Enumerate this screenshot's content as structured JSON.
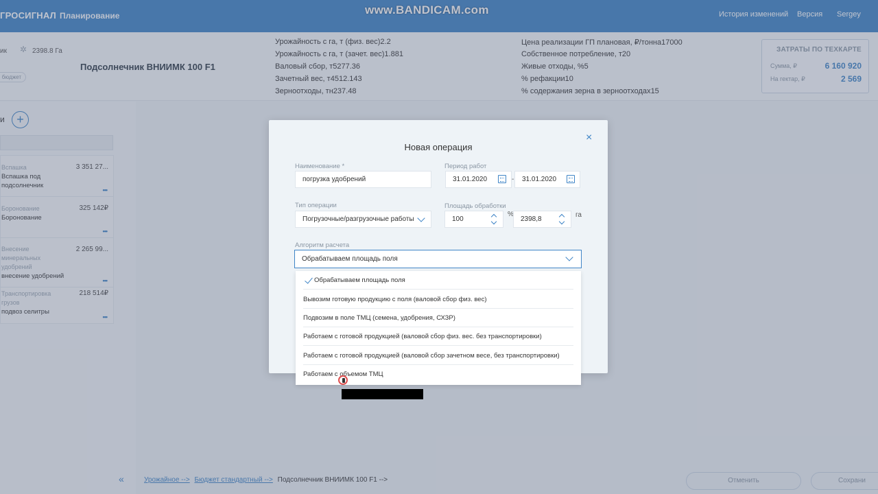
{
  "header": {
    "logo": "ГРОСИГНАЛ",
    "section": "Планирование",
    "watermark": "www.BANDICAM.com",
    "nav": [
      "История изменений",
      "Версия",
      "Sergey"
    ]
  },
  "info": {
    "lead": "ик",
    "area": "2398.8 Га",
    "crop_title": "Подсолнечник ВНИИМК 100 F1",
    "badge": "бюджет",
    "stats_col1": [
      {
        "label": "Урожайность с га, т (физ. вес)",
        "value": "2.2"
      },
      {
        "label": "Урожайность с га, т (зачет. вес)",
        "value": "1.881"
      },
      {
        "label": "Валовый сбор, т",
        "value": "5277.36"
      },
      {
        "label": "Зачетный вес, т",
        "value": "4512.143"
      },
      {
        "label": "Зерноотходы, тн",
        "value": "237.48"
      }
    ],
    "stats_col2": [
      {
        "label": "Цена реализации ГП плановая, ₽/тонна",
        "value": "17000"
      },
      {
        "label": "Собственное потребление, т",
        "value": "20"
      },
      {
        "label": "Живые отходы, %",
        "value": "5"
      },
      {
        "label": "% рефакции",
        "value": "10"
      },
      {
        "label": "% содержания зерна в зерноотходах",
        "value": "15"
      }
    ],
    "costs": {
      "caption": "ЗАТРАТЫ ПО ТЕХКАРТЕ",
      "sum_label": "Сумма, ₽",
      "sum_value": "6 160 920",
      "per_ha_label": "На гектар, ₽",
      "per_ha_value": "2 569"
    }
  },
  "left": {
    "title": "и",
    "plus": "+",
    "operations": [
      {
        "category": "Вспашка",
        "name": "Вспашка под подсолнечник",
        "sum": "3 351 27..."
      },
      {
        "category": "Боронование",
        "name": "Боронование",
        "sum": "325 142₽"
      },
      {
        "category": "Внесение минеральных удобрений",
        "name": "внесение удобрений",
        "sum": "2 265 99..."
      },
      {
        "category": "Транспортировка грузов",
        "name": "подвоз селитры",
        "sum": "218 514₽"
      }
    ],
    "dots": "•••",
    "collapse": "«"
  },
  "footer": {
    "breadcrumbs": [
      "Урожайное -->",
      "Бюджет стандартный -->",
      "Подсолнечник ВНИИМК 100 F1 -->"
    ],
    "cancel": "Отменить",
    "save": "Сохрани"
  },
  "modal": {
    "title": "Новая операция",
    "close": "×",
    "name_label": "Наименование *",
    "name_value": "погрузка удобрений",
    "period_label": "Период работ",
    "date_from": "31.01.2020",
    "date_sep": "-",
    "date_to": "31.01.2020",
    "type_label": "Тип операции",
    "type_value": "Погрузочные/разгрузочные работы",
    "area_label": "Площадь обработки",
    "area_percent": "100",
    "percent_sign": "%",
    "area_ha": "2398,8",
    "ha_unit": "га",
    "algo_label": "Алгоритм расчета",
    "algo_value": "Обрабатываем площадь поля"
  },
  "dropdown": {
    "options": [
      "Обрабатываем площадь поля",
      "Вывозим готовую продукцию с поля (валовой сбор физ. вес)",
      "Подвозим в поле ТМЦ (семена, удобрения, СХЗР)",
      "Работаем с готовой продукцией (валовой сбор физ. вес. без транспортировки)",
      "Работаем с готовой продукцией (валовой сбор зачетном весе, без транспортировки)",
      "Работаем с объемом ТМЦ"
    ],
    "selected_index": 0
  }
}
